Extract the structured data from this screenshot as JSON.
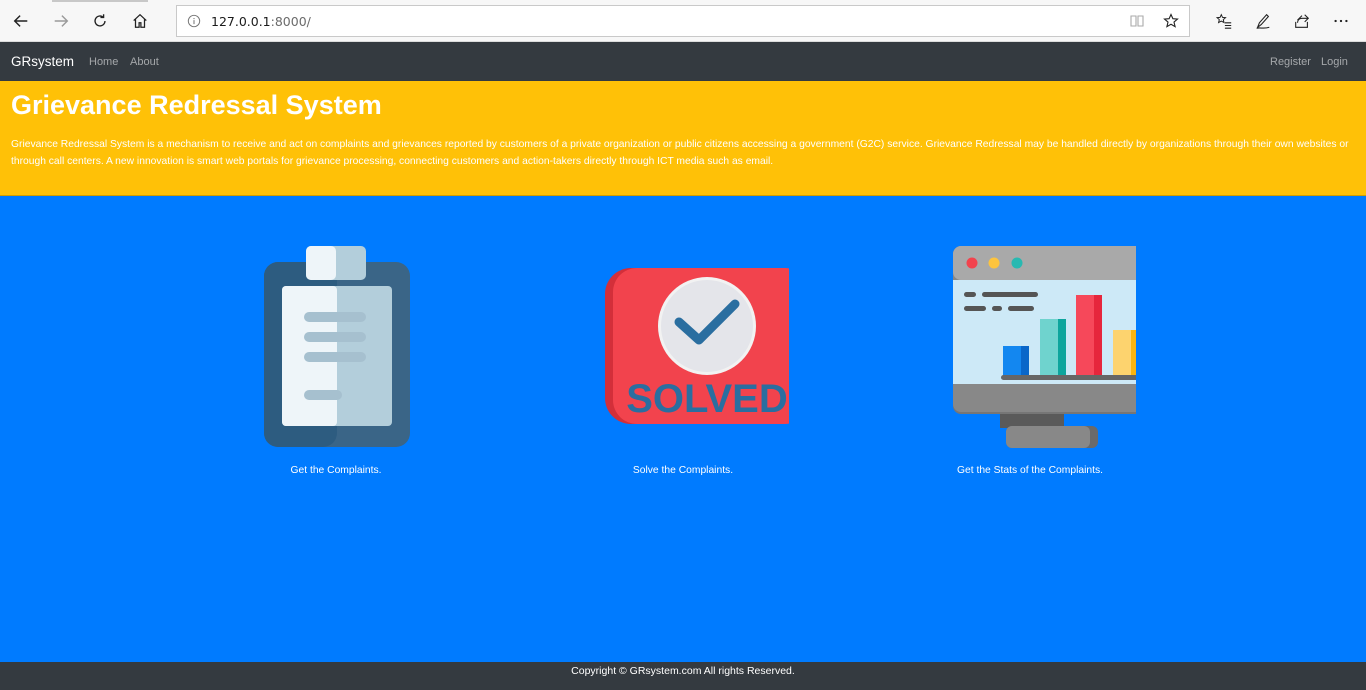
{
  "browser": {
    "url_host": "127.0.0.1",
    "url_rest": ":8000/"
  },
  "navbar": {
    "brand": "GRsystem",
    "links": [
      "Home",
      "About"
    ],
    "right_links": [
      "Register",
      "Login"
    ]
  },
  "jumbotron": {
    "title": "Grievance Redressal System",
    "description": "Grievance Redressal System is a mechanism to receive and act on complaints and grievances reported by customers of a private organization or public citizens accessing a government (G2C) service. Grievance Redressal may be handled directly by organizations through their own websites or through call centers. A new innovation is smart web portals for grievance processing, connecting customers and action-takers directly through ICT media such as email."
  },
  "features": [
    {
      "icon": "clipboard-icon",
      "label": "Get the Complaints."
    },
    {
      "icon": "solved-icon",
      "label": "Solve the Complaints.",
      "badge_text": "SOLVED"
    },
    {
      "icon": "stats-monitor-icon",
      "label": "Get the Stats of the Complaints."
    }
  ],
  "footer": {
    "copyright": "Copyright © GRsystem.com All rights Reserved."
  },
  "colors": {
    "page_bg": "#007bff",
    "navbar_bg": "#343a40",
    "jumbotron_bg": "#ffc107"
  }
}
